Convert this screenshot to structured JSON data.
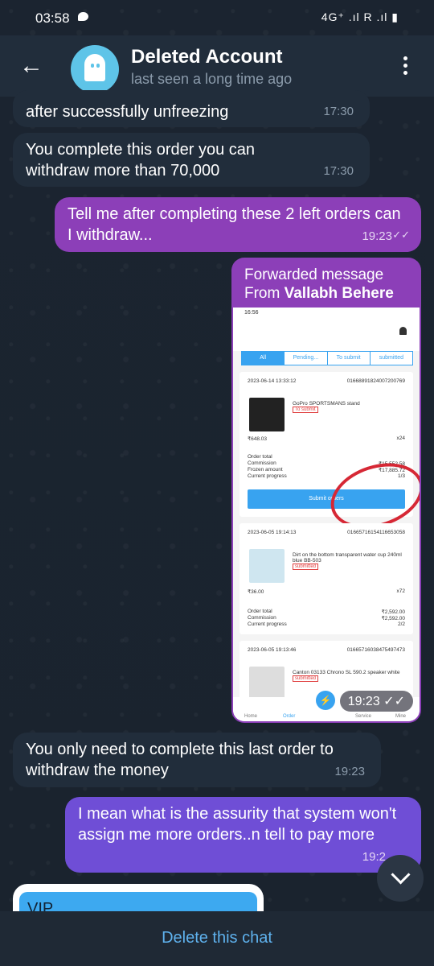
{
  "status_bar": {
    "time": "03:58",
    "right": "4G⁺ .ıl  R .ıl ▮"
  },
  "header": {
    "name": "Deleted Account",
    "subtitle": "last seen a long time ago"
  },
  "messages": [
    {
      "text": "after successfully unfreezing",
      "time": "17:30"
    },
    {
      "text": "You complete this order you can withdraw more than 70,000",
      "time": "17:30"
    },
    {
      "text": "Tell me after completing these 2 left orders can I withdraw...",
      "time": "19:23"
    },
    {
      "text": "You only need to complete this last order to withdraw the money",
      "time": "19:23"
    },
    {
      "text": "I mean what is the assurity that system won't assign me more orders..n tell to pay more",
      "time": "19:2"
    }
  ],
  "forward": {
    "label": "Forwarded message",
    "from_prefix": "From ",
    "from_name": "Vallabh Behere",
    "time": "19:23",
    "screenshot": {
      "status_time": "16:56",
      "tabs": [
        "All",
        "Pending...",
        "To submit",
        "submitted"
      ],
      "orders": [
        {
          "date": "2023-06-14 13:33:12",
          "id": "01668891824007200769",
          "product": "GoPro SPORTSMANS stand",
          "status": "To submit",
          "price": "₹648.03",
          "qty": "x24",
          "totals": [
            [
              "Order total",
              ""
            ],
            [
              "Commission",
              "₹15,552.58"
            ],
            [
              "Frozen amount",
              "₹17,885.72"
            ],
            [
              "Current progress",
              "1/3"
            ]
          ],
          "submit_label": "Submit orders"
        },
        {
          "date": "2023-06-05 19:14:13",
          "id": "01665716154116653058",
          "product": "Dirt on the bottom transparent water cup 240ml blue BB-503",
          "status": "submitted",
          "price": "₹36.00",
          "qty": "x72",
          "totals": [
            [
              "Order total",
              "₹2,592.00"
            ],
            [
              "Commission",
              "₹2,592.00"
            ],
            [
              "Current progress",
              "2/2"
            ]
          ]
        },
        {
          "date": "2023-06-05 19:13:46",
          "id": "01665716038475497473",
          "product": "Canton 03133 Chrono SL 590.2 speaker white",
          "status": "submitted"
        }
      ],
      "nav": [
        "Home",
        "Order",
        "Service",
        "Mine"
      ]
    }
  },
  "vip_label": "VIP",
  "bottom_action": "Delete this chat",
  "colors": {
    "incoming": "#212d3b",
    "outgoing": "#8c3fb8",
    "accent": "#5fb2ee"
  }
}
